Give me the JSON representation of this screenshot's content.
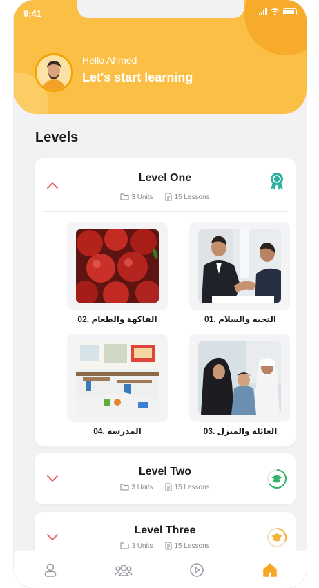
{
  "status": {
    "time": "9:41"
  },
  "header": {
    "greeting": "Hello Ahmed",
    "tagline": "Let's start learning"
  },
  "section_title": "Levels",
  "levels": [
    {
      "title": "Level One",
      "units": "3 Units",
      "lessons": "15 Lessons",
      "state": "expanded",
      "units_list": [
        {
          "label": "01. التحيه والسلام",
          "image": "handshake-photo"
        },
        {
          "label": "02. الفاكهة والطعام",
          "image": "apples-photo"
        },
        {
          "label": "03. العائله والمنزل",
          "image": "family-photo"
        },
        {
          "label": "04. المدرسه",
          "image": "classroom-photo"
        }
      ]
    },
    {
      "title": "Level Two",
      "units": "3 Units",
      "lessons": "15 Lessons",
      "state": "collapsed",
      "badge_color": "#34b36b"
    },
    {
      "title": "Level Three",
      "units": "3 Units",
      "lessons": "15 Lessons",
      "state": "collapsed",
      "badge_color": "#f5b335"
    }
  ],
  "tabs": [
    "profile-icon",
    "community-icon",
    "video-icon",
    "home-icon"
  ],
  "colors": {
    "accent": "#fbbf45",
    "chevron": "#ee6b6b",
    "active_tab": "#f5a623",
    "inactive_tab": "#9a9aa6"
  }
}
